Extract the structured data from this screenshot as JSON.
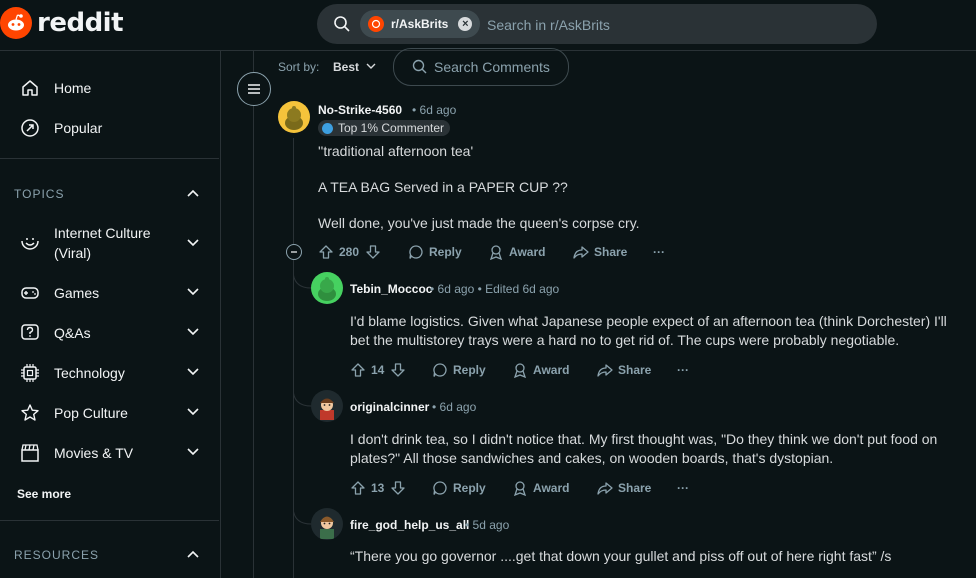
{
  "app": {
    "brand": "reddit",
    "accent": "#ff4500"
  },
  "search": {
    "chip_label": "r/AskBrits",
    "placeholder": "Search in r/AskBrits"
  },
  "sidebar": {
    "items": [
      {
        "label": "Home",
        "icon": "home-icon"
      },
      {
        "label": "Popular",
        "icon": "popular-icon"
      }
    ],
    "topics_heading": "TOPICS",
    "topics": [
      {
        "label": "Internet Culture",
        "label2": "(Viral)",
        "icon": "smile-icon"
      },
      {
        "label": "Games",
        "icon": "gamepad-icon"
      },
      {
        "label": "Q&As",
        "icon": "question-icon"
      },
      {
        "label": "Technology",
        "icon": "chip-icon"
      },
      {
        "label": "Pop Culture",
        "icon": "star-icon"
      },
      {
        "label": "Movies & TV",
        "icon": "clapperboard-icon"
      }
    ],
    "see_more": "See more",
    "resources_heading": "RESOURCES"
  },
  "sort": {
    "label": "Sort by:",
    "value": "Best"
  },
  "comment_search": {
    "placeholder": "Search Comments"
  },
  "comments": [
    {
      "author": "No-Strike-4560",
      "time": "• 6d ago",
      "badge": "Top 1% Commenter",
      "body": [
        "''traditional afternoon tea'",
        "A TEA BAG Served in a PAPER CUP ??",
        "Well done, you've just made the queen's corpse cry."
      ],
      "votes": "280",
      "reply": "Reply",
      "award": "Award",
      "share": "Share",
      "more": "···"
    },
    {
      "author": "Tebin_Moccoc",
      "time": "• 6d ago • Edited 6d ago",
      "body": [
        "I'd blame logistics. Given what Japanese people expect of an afternoon tea (think Dorchester) I'll",
        "bet the multistorey trays were a hard no to get rid of. The cups were probably negotiable."
      ],
      "votes": "14",
      "reply": "Reply",
      "award": "Award",
      "share": "Share",
      "more": "···"
    },
    {
      "author": "originalcinner",
      "time": "• 6d ago",
      "body": [
        "I don't drink tea, so I didn't notice that. My first thought was, \"Do they think we don't put food on",
        "plates?\" All those sandwiches and cakes, on wooden boards, that's dystopian."
      ],
      "votes": "13",
      "reply": "Reply",
      "award": "Award",
      "share": "Share",
      "more": "···"
    },
    {
      "author": "fire_god_help_us_all",
      "time": "• 5d ago",
      "body": [
        "“There you go governor ....get that down your gullet and piss off out of here right fast” /s"
      ]
    }
  ]
}
